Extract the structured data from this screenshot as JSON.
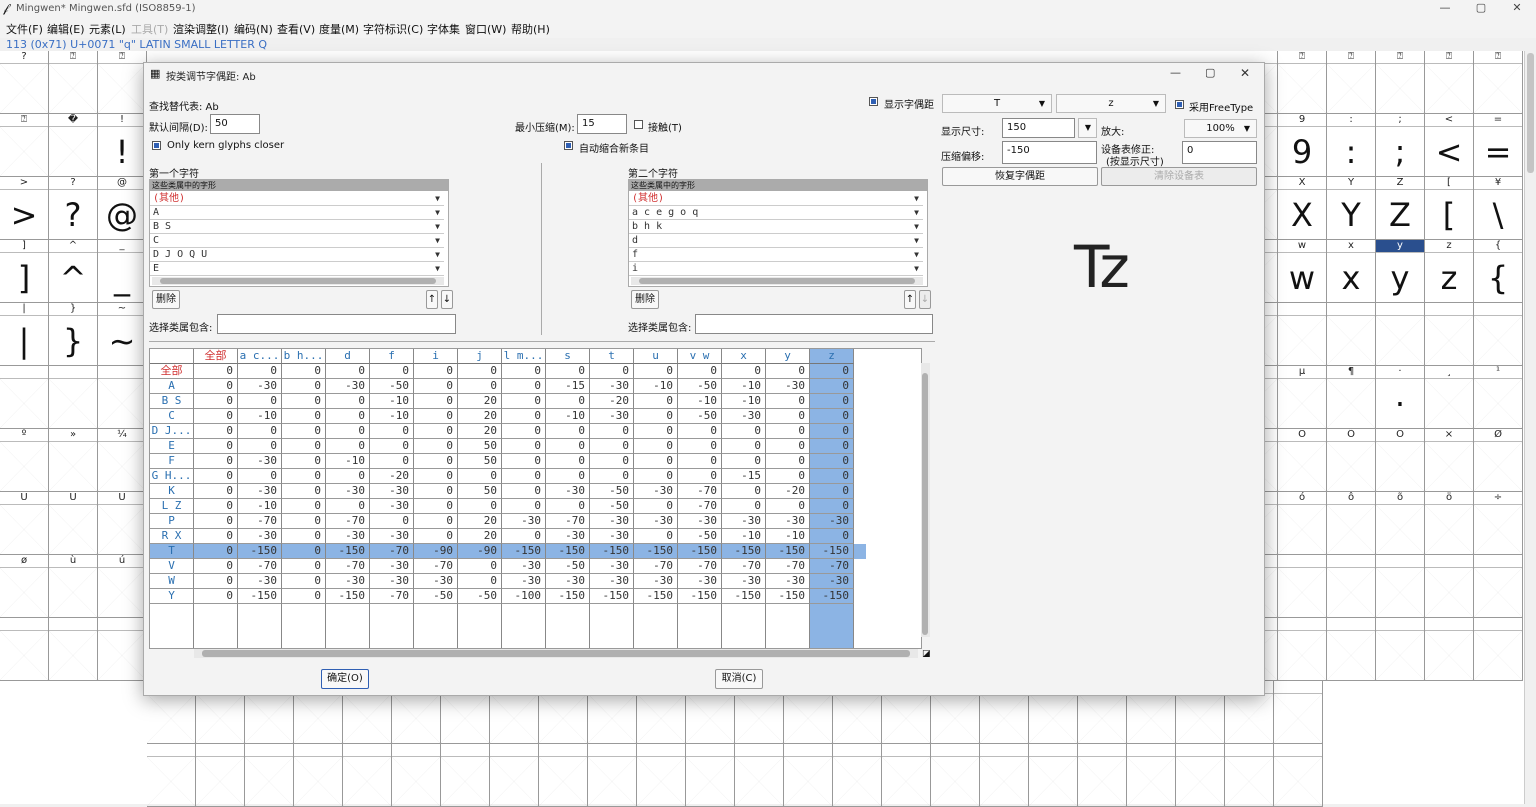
{
  "window": {
    "title": "Mingwen*  Mingwen.sfd (ISO8859-1)",
    "controls": {
      "minimize": "—",
      "maximize": "▢",
      "close": "✕"
    }
  },
  "menu": [
    {
      "label": "文件(F)",
      "enabled": true
    },
    {
      "label": "编辑(E)",
      "enabled": true
    },
    {
      "label": "元素(L)",
      "enabled": true
    },
    {
      "label": "工具(T)",
      "enabled": false
    },
    {
      "label": "渲染调整(I)",
      "enabled": true
    },
    {
      "label": "编码(N)",
      "enabled": true
    },
    {
      "label": "查看(V)",
      "enabled": true
    },
    {
      "label": "度量(M)",
      "enabled": true
    },
    {
      "label": "字符标识(C)",
      "enabled": true
    },
    {
      "label": "字体集",
      "enabled": true
    },
    {
      "label": "窗口(W)",
      "enabled": true
    },
    {
      "label": "帮助(H)",
      "enabled": true
    }
  ],
  "glyph_info": "113 (0x71) U+0071 \"q\" LATIN SMALL LETTER Q",
  "grid_left": {
    "rows": [
      {
        "labels": [
          "?",
          "⍰",
          "⍰"
        ],
        "glyphs": [
          "",
          "",
          ""
        ]
      },
      {
        "labels": [
          "⍰",
          "�",
          "!"
        ],
        "glyphs": [
          "",
          "",
          "!"
        ]
      },
      {
        "labels": [
          ">",
          "?",
          "@"
        ],
        "glyphs": [
          ">",
          "?",
          "@"
        ]
      },
      {
        "labels": [
          "]",
          "^",
          "_"
        ],
        "glyphs": [
          "]",
          "^",
          "_"
        ]
      },
      {
        "labels": [
          "|",
          "}",
          "~"
        ],
        "glyphs": [
          "|",
          "}",
          "~"
        ]
      },
      {
        "labels": [
          "",
          "",
          ""
        ],
        "glyphs": [
          "",
          "",
          ""
        ]
      },
      {
        "labels": [
          "º",
          "»",
          "¼"
        ],
        "glyphs": [
          "",
          "",
          ""
        ]
      },
      {
        "labels": [
          "Ù",
          "Ú",
          "Û"
        ],
        "glyphs": [
          "",
          "",
          ""
        ]
      },
      {
        "labels": [
          "ø",
          "ù",
          "ú"
        ],
        "glyphs": [
          "",
          "",
          ""
        ]
      },
      {
        "labels": [
          "",
          "",
          ""
        ],
        "glyphs": [
          "",
          "",
          ""
        ]
      }
    ]
  },
  "grid_right": {
    "rows": [
      {
        "labels": [
          "⍰",
          "⍰",
          "⍰",
          "⍰",
          "⍰"
        ],
        "glyphs": [
          "",
          "",
          "",
          "",
          ""
        ]
      },
      {
        "labels": [
          "9",
          ":",
          ";",
          "<",
          "="
        ],
        "glyphs": [
          "9",
          ":",
          ";",
          "<",
          "="
        ]
      },
      {
        "labels": [
          "X",
          "Y",
          "Z",
          "[",
          "¥"
        ],
        "glyphs": [
          "X",
          "Y",
          "Z",
          "[",
          "\\"
        ]
      },
      {
        "labels": [
          "w",
          "x",
          "y",
          "z",
          "{"
        ],
        "glyphs": [
          "w",
          "x",
          "y",
          "z",
          "{"
        ]
      },
      {
        "labels": [
          "",
          "",
          "",
          "",
          ""
        ],
        "glyphs": [
          "",
          "",
          "",
          "",
          ""
        ]
      },
      {
        "labels": [
          "µ",
          "¶",
          "·",
          "¸",
          "¹"
        ],
        "glyphs": [
          "",
          "",
          "·",
          "",
          ""
        ]
      },
      {
        "labels": [
          "Ô",
          "Õ",
          "Ö",
          "×",
          "Ø"
        ],
        "glyphs": [
          "",
          "",
          "",
          "",
          ""
        ]
      },
      {
        "labels": [
          "ó",
          "ô",
          "õ",
          "ö",
          "÷"
        ],
        "glyphs": [
          "",
          "",
          "",
          "",
          ""
        ]
      },
      {
        "labels": [
          "",
          "",
          "",
          "",
          ""
        ],
        "glyphs": [
          "",
          "",
          "",
          "",
          ""
        ]
      },
      {
        "labels": [
          "",
          "",
          "",
          "",
          ""
        ],
        "glyphs": [
          "",
          "",
          "",
          "",
          ""
        ]
      }
    ]
  },
  "dialog": {
    "title": "按类调节字偶距: Ab",
    "lookup_label": "查找替代表: Ab",
    "default_spacing_label": "默认间隔(D):",
    "default_spacing_value": "50",
    "min_kern_label": "最小压缩(M):",
    "min_kern_value": "15",
    "touch_label": "接触(T)",
    "touch_checked": false,
    "only_closer_label": "Only kern glyphs closer",
    "only_closer_checked": true,
    "auto_kern_label": "自动缩合新条目",
    "auto_kern_checked": true,
    "show_kerning_label": "显示字偶距",
    "show_kerning_checked": true,
    "first_glyph_combo": "T",
    "second_glyph_combo": "z",
    "freetype_label": "采用FreeType",
    "freetype_checked": true,
    "display_size_label": "显示尺寸:",
    "display_size_value": "150",
    "magnify_label": "放大:",
    "magnify_value": "100%",
    "kern_offset_label": "压缩偏移:",
    "kern_offset_value": "-150",
    "device_table_label": "设备表修正:",
    "device_table_sub": "(按显示尺寸)",
    "device_table_value": "0",
    "revert_button": "恢复字偶距",
    "clear_device_button": "清除设备表",
    "preview_text": "Tz",
    "first_class_title": "第一个字符",
    "second_class_title": "第二个字符",
    "class_header": "这些类属中的字形",
    "first_classes": [
      "(其他)",
      "A",
      "B S",
      "C",
      "D J O Q U",
      "E"
    ],
    "second_classes": [
      "(其他)",
      "a c e g o q",
      "b h k",
      "d",
      "f",
      "i"
    ],
    "delete_button": "删除",
    "up_arrow": "↑",
    "down_arrow": "↓",
    "select_class_label": "选择类属包含:",
    "ok_button": "确定(O)",
    "cancel_button": "取消(C)"
  },
  "kern_table": {
    "corner": "全部",
    "columns": [
      "a c...",
      "b h...",
      "d",
      "f",
      "i",
      "j",
      "l m...",
      "s",
      "t",
      "u",
      "v w",
      "x",
      "y",
      "z"
    ],
    "rows": [
      {
        "label": "全部",
        "values": [
          "0",
          "0",
          "0",
          "0",
          "0",
          "0",
          "0",
          "0",
          "0",
          "0",
          "0",
          "0",
          "0",
          "0",
          "0"
        ]
      },
      {
        "label": "A",
        "values": [
          "0",
          "-30",
          "0",
          "-30",
          "-50",
          "0",
          "0",
          "0",
          "-15",
          "-30",
          "-10",
          "-50",
          "-10",
          "-30",
          "0"
        ]
      },
      {
        "label": "B S",
        "values": [
          "0",
          "0",
          "0",
          "0",
          "-10",
          "0",
          "20",
          "0",
          "0",
          "-20",
          "0",
          "-10",
          "-10",
          "0",
          "0"
        ]
      },
      {
        "label": "C",
        "values": [
          "0",
          "-10",
          "0",
          "0",
          "-10",
          "0",
          "20",
          "0",
          "-10",
          "-30",
          "0",
          "-50",
          "-30",
          "0",
          "0"
        ]
      },
      {
        "label": "D J...",
        "values": [
          "0",
          "0",
          "0",
          "0",
          "0",
          "0",
          "20",
          "0",
          "0",
          "0",
          "0",
          "0",
          "0",
          "0",
          "0"
        ]
      },
      {
        "label": "E",
        "values": [
          "0",
          "0",
          "0",
          "0",
          "0",
          "0",
          "50",
          "0",
          "0",
          "0",
          "0",
          "0",
          "0",
          "0",
          "0"
        ]
      },
      {
        "label": "F",
        "values": [
          "0",
          "-30",
          "0",
          "-10",
          "0",
          "0",
          "50",
          "0",
          "0",
          "0",
          "0",
          "0",
          "0",
          "0",
          "0"
        ]
      },
      {
        "label": "G H...",
        "values": [
          "0",
          "0",
          "0",
          "0",
          "-20",
          "0",
          "0",
          "0",
          "0",
          "0",
          "0",
          "0",
          "-15",
          "0",
          "0"
        ]
      },
      {
        "label": "K",
        "values": [
          "0",
          "-30",
          "0",
          "-30",
          "-30",
          "0",
          "50",
          "0",
          "-30",
          "-50",
          "-30",
          "-70",
          "0",
          "-20",
          "0"
        ]
      },
      {
        "label": "L Z",
        "values": [
          "0",
          "-10",
          "0",
          "0",
          "-30",
          "0",
          "0",
          "0",
          "0",
          "-50",
          "0",
          "-70",
          "0",
          "0",
          "0"
        ]
      },
      {
        "label": "P",
        "values": [
          "0",
          "-70",
          "0",
          "-70",
          "0",
          "0",
          "20",
          "-30",
          "-70",
          "-30",
          "-30",
          "-30",
          "-30",
          "-30",
          "-30"
        ]
      },
      {
        "label": "R X",
        "values": [
          "0",
          "-30",
          "0",
          "-30",
          "-30",
          "0",
          "20",
          "0",
          "-30",
          "-30",
          "0",
          "-50",
          "-10",
          "-10",
          "0"
        ]
      },
      {
        "label": "T",
        "values": [
          "0",
          "-150",
          "0",
          "-150",
          "-70",
          "-90",
          "-90",
          "-150",
          "-150",
          "-150",
          "-150",
          "-150",
          "-150",
          "-150",
          "-150"
        ]
      },
      {
        "label": "V",
        "values": [
          "0",
          "-70",
          "0",
          "-70",
          "-30",
          "-70",
          "0",
          "-30",
          "-50",
          "-30",
          "-70",
          "-70",
          "-70",
          "-70",
          "-70"
        ]
      },
      {
        "label": "W",
        "values": [
          "0",
          "-30",
          "0",
          "-30",
          "-30",
          "-30",
          "0",
          "-30",
          "-30",
          "-30",
          "-30",
          "-30",
          "-30",
          "-30",
          "-30"
        ]
      },
      {
        "label": "Y",
        "values": [
          "0",
          "-150",
          "0",
          "-150",
          "-70",
          "-50",
          "-50",
          "-100",
          "-150",
          "-150",
          "-150",
          "-150",
          "-150",
          "-150",
          "-150"
        ]
      }
    ],
    "selected_row": "T",
    "selected_column": "z"
  }
}
